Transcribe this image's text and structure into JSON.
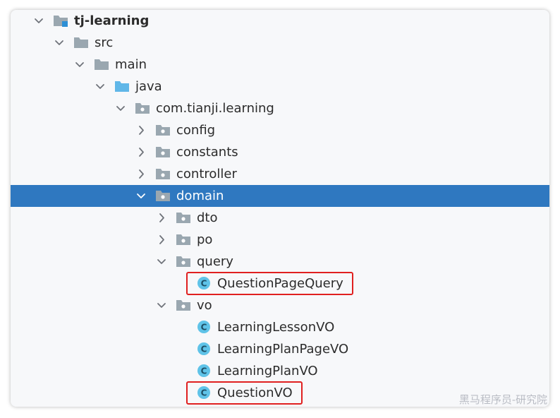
{
  "tree": {
    "rows": [
      {
        "label": "tj-learning",
        "icon": "module-folder-icon",
        "expanded": true,
        "bold": true
      },
      {
        "label": "src",
        "icon": "folder-icon",
        "expanded": true
      },
      {
        "label": "main",
        "icon": "folder-icon",
        "expanded": true
      },
      {
        "label": "java",
        "icon": "source-root-folder-icon",
        "expanded": true
      },
      {
        "label": "com.tianji.learning",
        "icon": "package-icon",
        "expanded": true
      },
      {
        "label": "config",
        "icon": "package-icon",
        "expanded": false
      },
      {
        "label": "constants",
        "icon": "package-icon",
        "expanded": false
      },
      {
        "label": "controller",
        "icon": "package-icon",
        "expanded": false
      },
      {
        "label": "domain",
        "icon": "package-icon",
        "expanded": true,
        "selected": true
      },
      {
        "label": "dto",
        "icon": "package-icon",
        "expanded": false
      },
      {
        "label": "po",
        "icon": "package-icon",
        "expanded": false
      },
      {
        "label": "query",
        "icon": "package-icon",
        "expanded": true
      },
      {
        "label": "QuestionPageQuery",
        "icon": "java-class-icon",
        "highlighted": true
      },
      {
        "label": "vo",
        "icon": "package-icon",
        "expanded": true
      },
      {
        "label": "LearningLessonVO",
        "icon": "java-class-icon"
      },
      {
        "label": "LearningPlanPageVO",
        "icon": "java-class-icon"
      },
      {
        "label": "LearningPlanVO",
        "icon": "java-class-icon"
      },
      {
        "label": "QuestionVO",
        "icon": "java-class-icon",
        "highlighted": true
      }
    ]
  },
  "class_icon_letter": "C",
  "watermark": "黑马程序员-研究院",
  "colors": {
    "selection": "#2f78c0",
    "highlight_border": "#e02020",
    "folder": "#9aa7b0",
    "source_folder": "#60b7e8",
    "class_icon": "#5fc3e8"
  }
}
